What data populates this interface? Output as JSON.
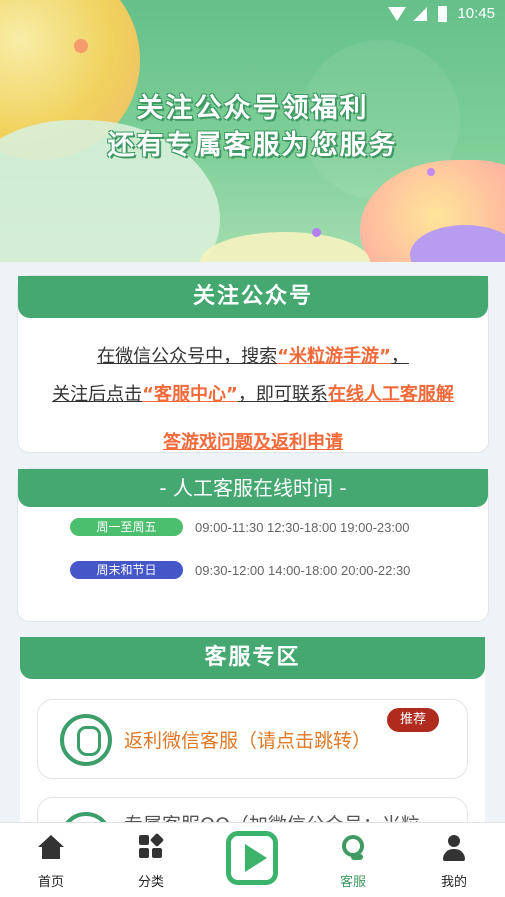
{
  "status_bar": {
    "time": "10:45"
  },
  "banner": {
    "line1": "关注公众号领福利",
    "line2": "还有专属客服为您服务"
  },
  "follow_card": {
    "title": "关注公众号",
    "line1_prefix": "在微信公众号中，搜索",
    "line1_highlight": "“米粒游手游”",
    "line1_suffix": "，",
    "line2_prefix": "关注后点击",
    "line2_highlight1": "“客服中心”",
    "line2_mid": "，即可联系",
    "line2_highlight2": "在线人工客服解",
    "line3_highlight": "答游戏问题及返利申请"
  },
  "hours_card": {
    "title": "- 人工客服在线时间 -",
    "rows": [
      {
        "label": "周一至周五",
        "times": "09:00-11:30 12:30-18:00 19:00-23:00",
        "color": "#4cbf6e"
      },
      {
        "label": "周末和节日",
        "times": "09:30-12:00 14:00-18:00 20:00-22:30",
        "color": "#4557c8"
      }
    ]
  },
  "service_zone": {
    "title": "客服专区",
    "items": [
      {
        "label": "返利微信客服（请点击跳转）",
        "badge": "推荐",
        "icon": "qq-icon"
      },
      {
        "label": "专属客服QQ（加微信公众号：米粒",
        "icon": "qq-icon"
      }
    ]
  },
  "tabbar": {
    "tabs": [
      {
        "label": "首页",
        "icon": "home-icon"
      },
      {
        "label": "分类",
        "icon": "category-icon"
      },
      {
        "label": "",
        "icon": "play-icon"
      },
      {
        "label": "客服",
        "icon": "headset-icon",
        "active": true
      },
      {
        "label": "我的",
        "icon": "user-icon"
      }
    ]
  },
  "colors": {
    "primary_green": "#44a870",
    "highlight_orange": "#f26a3a",
    "badge_red": "#b02a1e"
  }
}
